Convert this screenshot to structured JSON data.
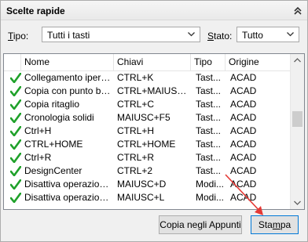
{
  "panel": {
    "title": "Scelte rapide"
  },
  "filters": {
    "tipo_label_acc": "T",
    "tipo_label_rest": "ipo:",
    "tipo_value": "Tutti i tasti",
    "stato_label_acc": "S",
    "stato_label_rest": "tato:",
    "stato_value": "Tutto"
  },
  "table": {
    "columns": [
      "Nome",
      "Chiavi",
      "Tipo",
      "Origine"
    ],
    "rows": [
      [
        "Collegamento iperte...",
        "CTRL+K",
        "Tast...",
        "ACAD"
      ],
      [
        "Copia con punto base",
        "CTRL+MAIUSC+C",
        "Tast...",
        "ACAD"
      ],
      [
        "Copia ritaglio",
        "CTRL+C",
        "Tast...",
        "ACAD"
      ],
      [
        "Cronologia solidi",
        "MAIUSC+F5",
        "Tast...",
        "ACAD"
      ],
      [
        "Ctrl+H",
        "CTRL+H",
        "Tast...",
        "ACAD"
      ],
      [
        "CTRL+HOME",
        "CTRL+HOME",
        "Tast...",
        "ACAD"
      ],
      [
        "Ctrl+R",
        "CTRL+R",
        "Tast...",
        "ACAD"
      ],
      [
        "DesignCenter",
        "CTRL+2",
        "Tast...",
        "ACAD"
      ],
      [
        "Disattiva operazioni ...",
        "MAIUSC+D",
        "Modi...",
        "ACAD"
      ],
      [
        "Disattiva operazioni ...",
        "MAIUSC+L",
        "Modi...",
        "ACAD"
      ]
    ]
  },
  "buttons": {
    "copy_label": "Copia negli Appunti",
    "print_label_pre": "Sta",
    "print_label_acc": "m",
    "print_label_post": "pa"
  },
  "colors": {
    "check": "#1fa12a",
    "annotation_arrow": "#e53935",
    "focus_border": "#0078d7"
  }
}
